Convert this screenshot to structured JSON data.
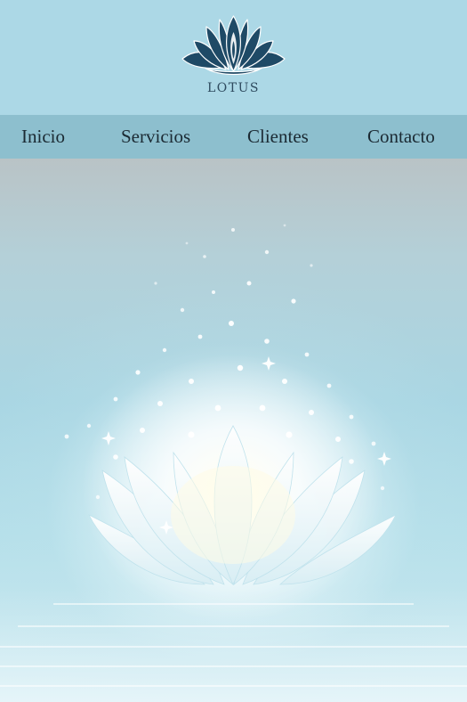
{
  "logo": {
    "text": "LOTUS",
    "icon": "lotus-flower-icon",
    "color": "#1f4a66"
  },
  "nav": {
    "items": [
      {
        "label": "Inicio"
      },
      {
        "label": "Servicios"
      },
      {
        "label": "Clientes"
      },
      {
        "label": "Contacto"
      }
    ]
  },
  "colors": {
    "header_bg": "#acd8e6",
    "nav_bg": "#8dbfce",
    "nav_text": "#1b2a33"
  },
  "hero": {
    "image": "glowing-white-lotus-on-water"
  }
}
